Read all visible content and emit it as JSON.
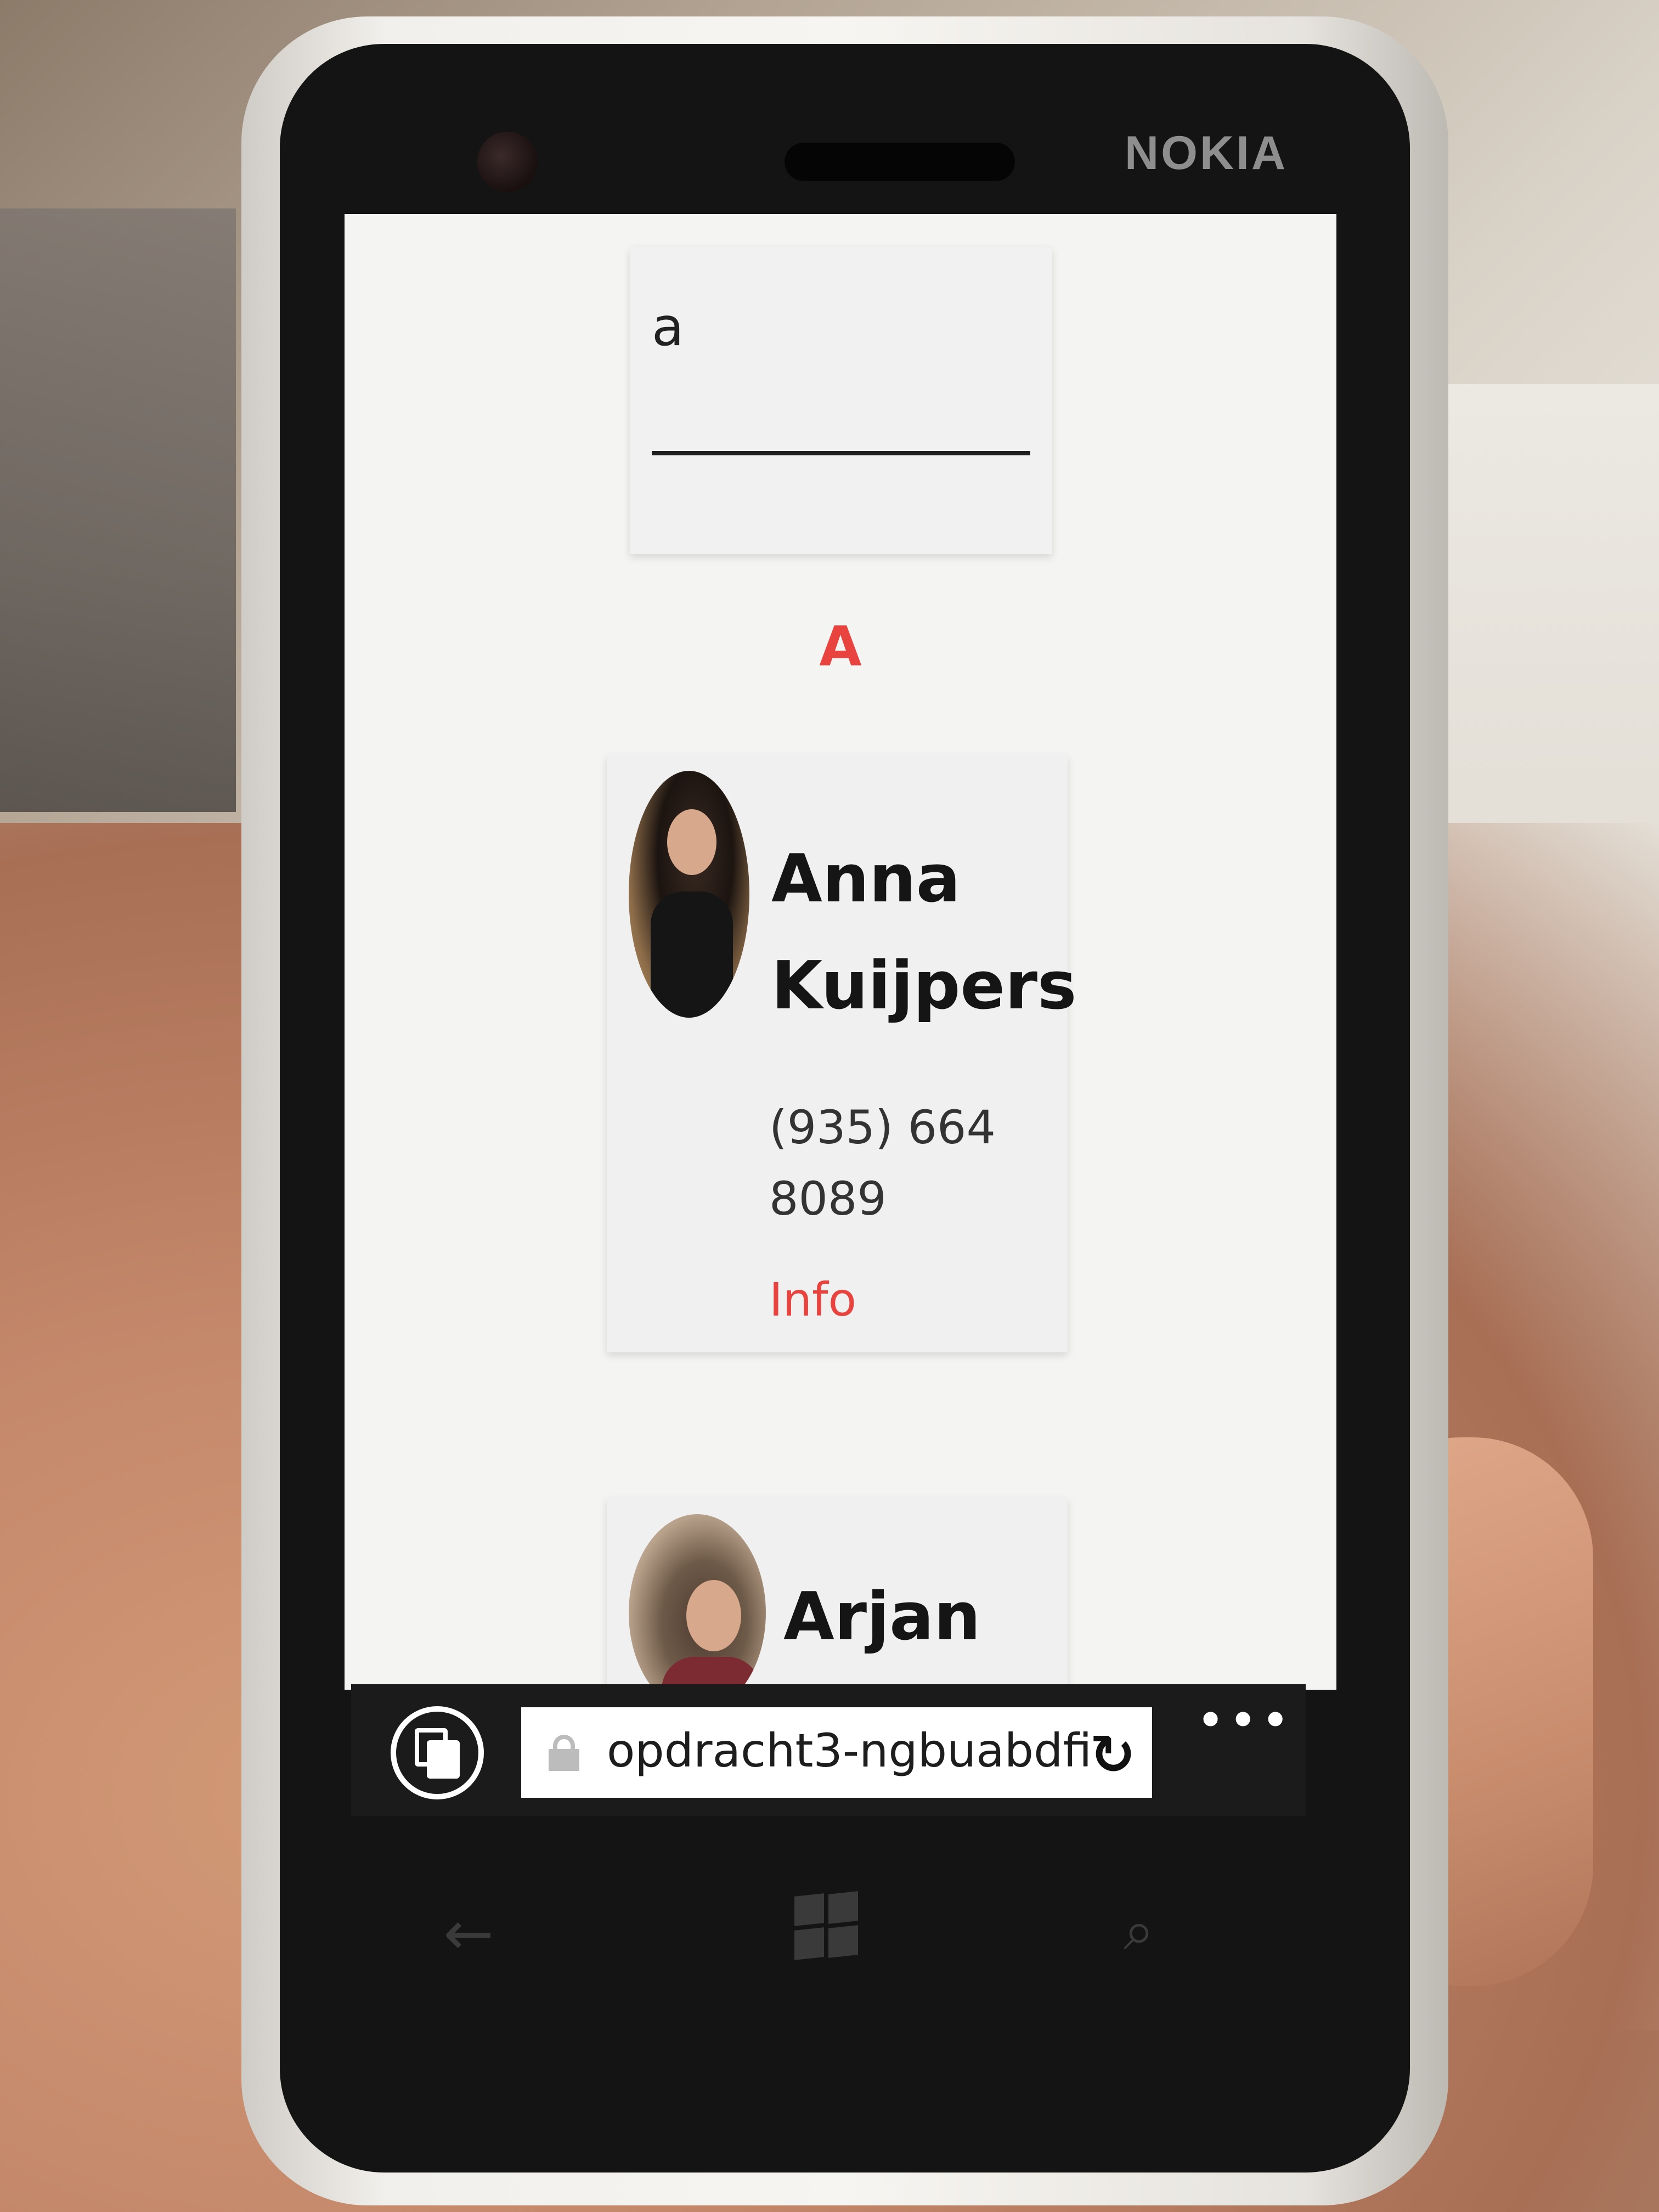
{
  "device": {
    "brand": "NOKIA"
  },
  "search": {
    "value": "a"
  },
  "section": {
    "letter": "A"
  },
  "contacts": [
    {
      "name": "Anna Kuijpers",
      "phone": "(935) 664 8089",
      "info_label": "Info"
    },
    {
      "name": "Arjan"
    }
  ],
  "browser": {
    "url": "opdracht3-ngbuabdfi"
  },
  "icons": {
    "tabs": "tabs-icon",
    "lock": "lock-icon",
    "refresh": "refresh-icon",
    "more": "more-icon",
    "back": "back-arrow-icon",
    "home": "windows-logo-icon",
    "search": "search-icon"
  },
  "colors": {
    "accent": "#e8433f",
    "screen_background": "#f4f4f2",
    "browser_bar": "#1b1b1b"
  }
}
